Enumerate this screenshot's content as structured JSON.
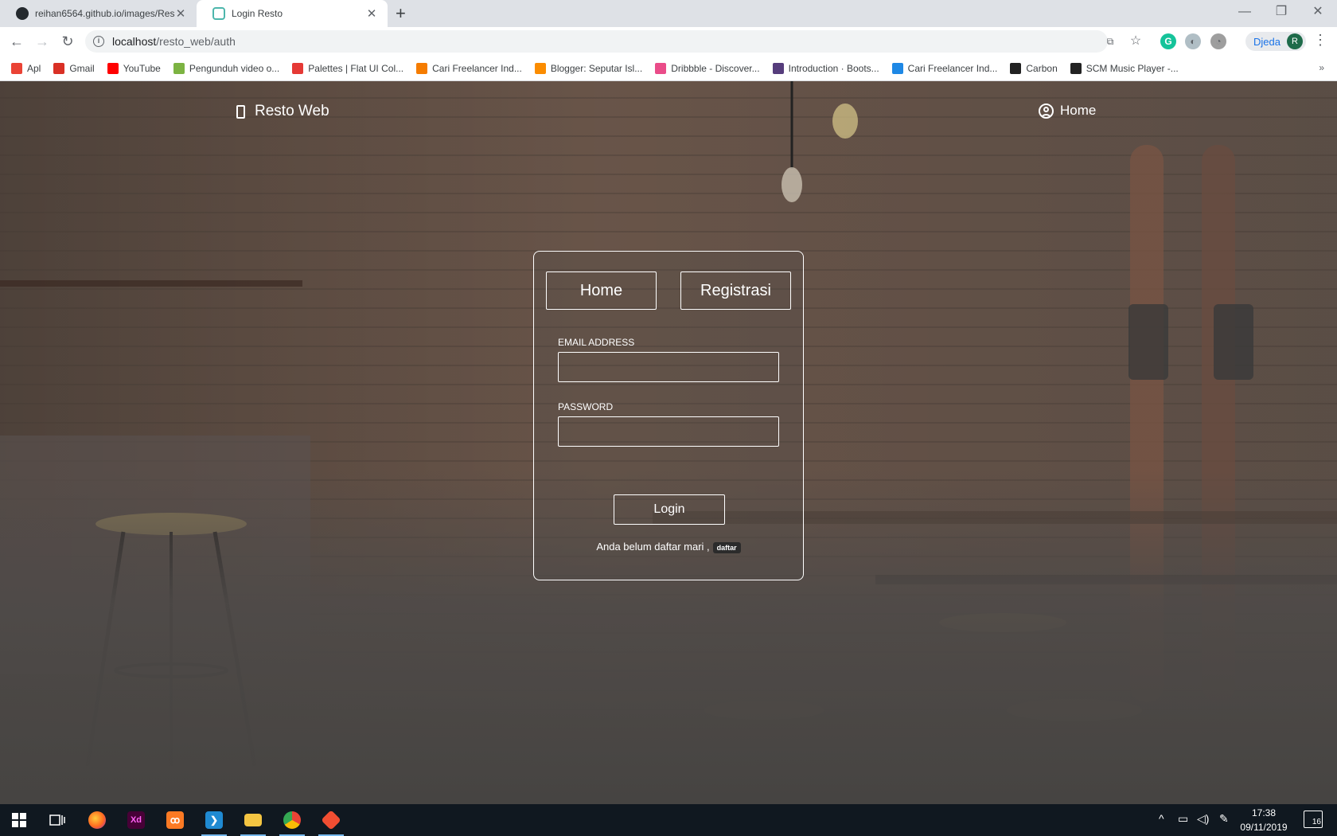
{
  "browser": {
    "tabs": [
      {
        "title": "reihan6564.github.io/images/Res",
        "favicon": "github-icon",
        "active": false
      },
      {
        "title": "Login Resto",
        "favicon": "resto-web-icon",
        "active": true
      }
    ],
    "url_host": "localhost",
    "url_path": "/resto_web/auth",
    "profile_name": "Djeda",
    "profile_initial": "R"
  },
  "bookmarks": [
    {
      "label": "Apl",
      "icon": "apps-grid-icon",
      "color": "#ea4335"
    },
    {
      "label": "Gmail",
      "icon": "gmail-icon",
      "color": "#d93025"
    },
    {
      "label": "YouTube",
      "icon": "youtube-icon",
      "color": "#ff0000"
    },
    {
      "label": "Pengunduh video o...",
      "icon": "download-icon",
      "color": "#7cb342"
    },
    {
      "label": "Palettes | Flat UI Col...",
      "icon": "palette-icon",
      "color": "#e53935"
    },
    {
      "label": "Cari Freelancer Ind...",
      "icon": "freelancer-icon",
      "color": "#f57c00"
    },
    {
      "label": "Blogger: Seputar Isl...",
      "icon": "blogger-icon",
      "color": "#fb8c00"
    },
    {
      "label": "Dribbble - Discover...",
      "icon": "dribbble-icon",
      "color": "#ea4c89"
    },
    {
      "label": "Introduction · Boots...",
      "icon": "bootstrap-icon",
      "color": "#563d7c"
    },
    {
      "label": "Cari Freelancer Ind...",
      "icon": "sribulancer-icon",
      "color": "#1e88e5"
    },
    {
      "label": "Carbon",
      "icon": "carbon-icon",
      "color": "#222222"
    },
    {
      "label": "SCM Music Player -...",
      "icon": "music-icon",
      "color": "#222222"
    }
  ],
  "site": {
    "brand": "Resto Web",
    "nav_home": "Home"
  },
  "login_card": {
    "home_button": "Home",
    "register_button": "Registrasi",
    "email_label": "EMAIL ADDRESS",
    "email_value": "",
    "password_label": "PASSWORD",
    "password_value": "",
    "login_button": "Login",
    "register_prompt": "Anda belum daftar mari ,",
    "register_badge": "daftar"
  },
  "taskbar": {
    "apps": [
      {
        "name": "windows-start-icon",
        "active": false
      },
      {
        "name": "task-view-icon",
        "active": false
      },
      {
        "name": "firefox-icon",
        "active": false
      },
      {
        "name": "adobe-xd-icon",
        "active": false
      },
      {
        "name": "xampp-icon",
        "active": false
      },
      {
        "name": "vscode-icon",
        "active": true
      },
      {
        "name": "file-explorer-icon",
        "active": true
      },
      {
        "name": "chrome-icon",
        "active": true
      },
      {
        "name": "git-icon",
        "active": true
      }
    ],
    "time": "17:38",
    "date": "09/11/2019",
    "notifications": "16"
  }
}
